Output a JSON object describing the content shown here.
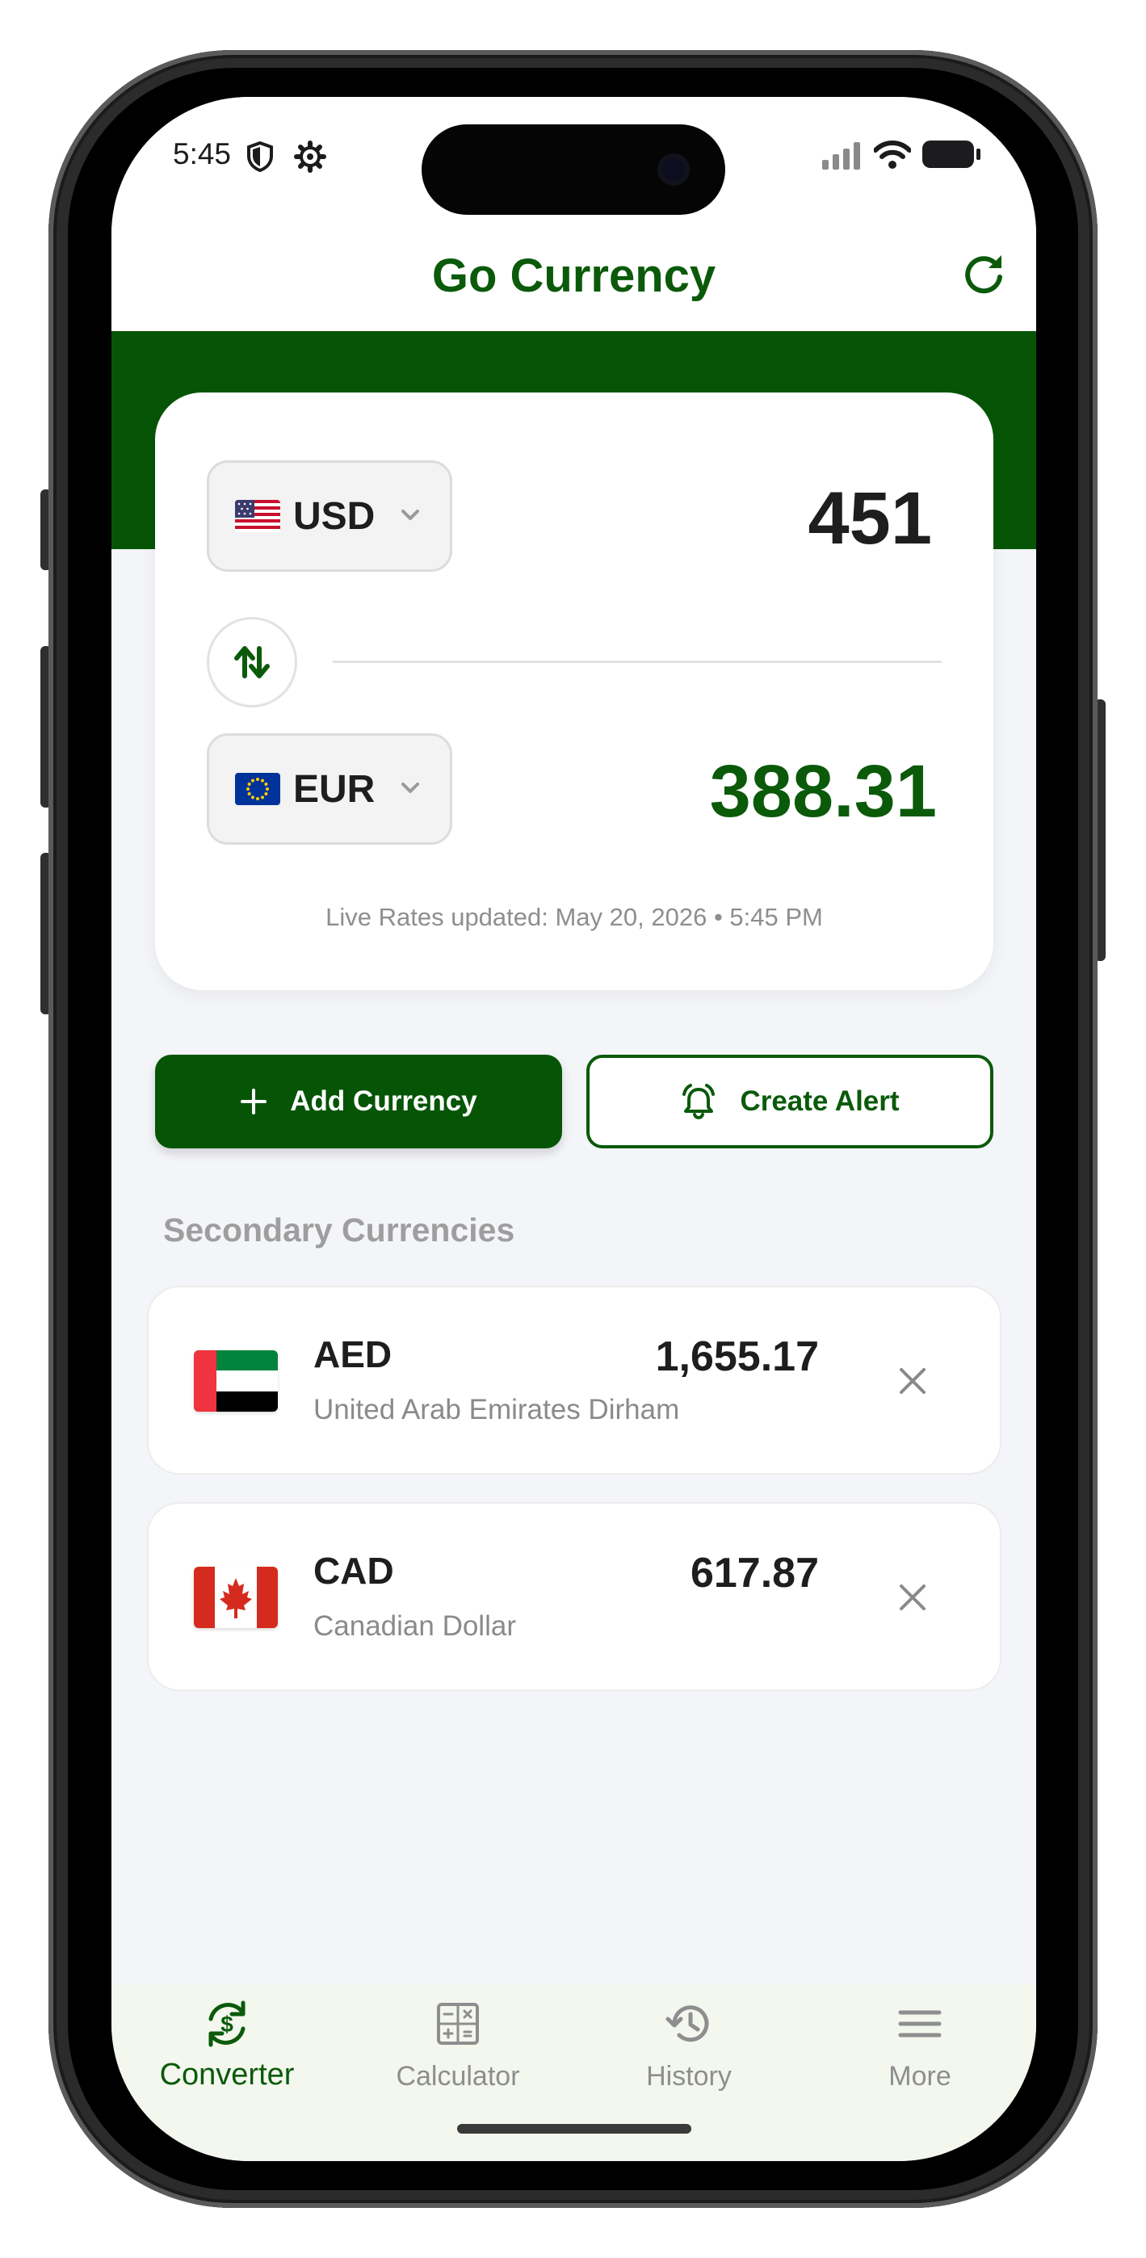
{
  "status_bar": {
    "time": "5:45",
    "left_icons": [
      "shield-icon",
      "gear-icon"
    ],
    "right_icons": [
      "cellular-signal-icon",
      "wifi-icon",
      "battery-icon"
    ]
  },
  "header": {
    "title": "Go Currency",
    "refresh_icon": "refresh-icon"
  },
  "converter": {
    "from": {
      "code": "USD",
      "flag": "us-flag",
      "amount": "451"
    },
    "to": {
      "code": "EUR",
      "flag": "eu-flag",
      "amount": "388.31"
    },
    "swap_icon": "swap-vertical-icon",
    "updated_text": "Live Rates updated: May 20, 2026 • 5:45 PM"
  },
  "actions": {
    "add_label": "Add Currency",
    "alert_label": "Create Alert"
  },
  "secondary": {
    "title": "Secondary Currencies",
    "items": [
      {
        "code": "AED",
        "name": "United Arab Emirates Dirham",
        "value": "1,655.17",
        "flag": "ae-flag"
      },
      {
        "code": "CAD",
        "name": "Canadian Dollar",
        "value": "617.87",
        "flag": "ca-flag"
      }
    ]
  },
  "nav": {
    "items": [
      {
        "label": "Converter",
        "icon": "currency-exchange-icon",
        "active": true
      },
      {
        "label": "Calculator",
        "icon": "calculator-icon",
        "active": false
      },
      {
        "label": "History",
        "icon": "history-icon",
        "active": false
      },
      {
        "label": "More",
        "icon": "menu-icon",
        "active": false
      }
    ]
  },
  "colors": {
    "brand": "#0a5a0a",
    "brand_dark": "#065506",
    "background": "#f4f5f9",
    "muted_text": "#8e8e8e"
  }
}
